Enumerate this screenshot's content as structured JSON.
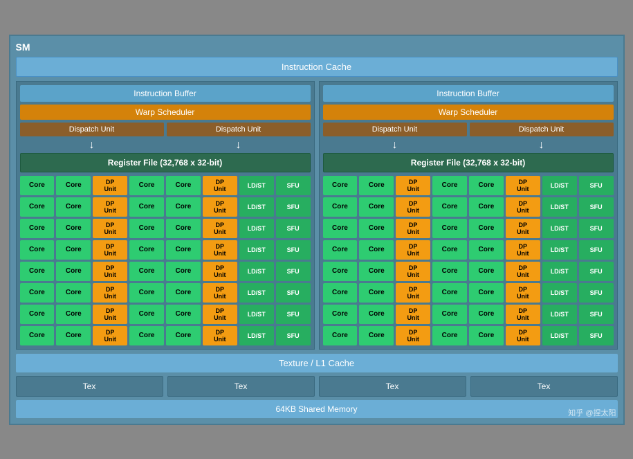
{
  "sm": {
    "label": "SM",
    "instruction_cache": "Instruction Cache",
    "left": {
      "instruction_buffer": "Instruction Buffer",
      "warp_scheduler": "Warp Scheduler",
      "dispatch_unit_1": "Dispatch Unit",
      "dispatch_unit_2": "Dispatch Unit",
      "register_file": "Register File (32,768 x 32-bit)"
    },
    "right": {
      "instruction_buffer": "Instruction Buffer",
      "warp_scheduler": "Warp Scheduler",
      "dispatch_unit_1": "Dispatch Unit",
      "dispatch_unit_2": "Dispatch Unit",
      "register_file": "Register File (32,768 x 32-bit)"
    },
    "texture_l1": "Texture / L1 Cache",
    "tex_labels": [
      "Tex",
      "Tex",
      "Tex",
      "Tex"
    ],
    "shared_memory": "64KB Shared Memory",
    "watermark": "知乎 @捏太阳",
    "core_label": "Core",
    "dp_unit_label": "DP\nUnit",
    "ldst_label": "LD/ST",
    "sfu_label": "SFU",
    "num_rows": 8
  }
}
